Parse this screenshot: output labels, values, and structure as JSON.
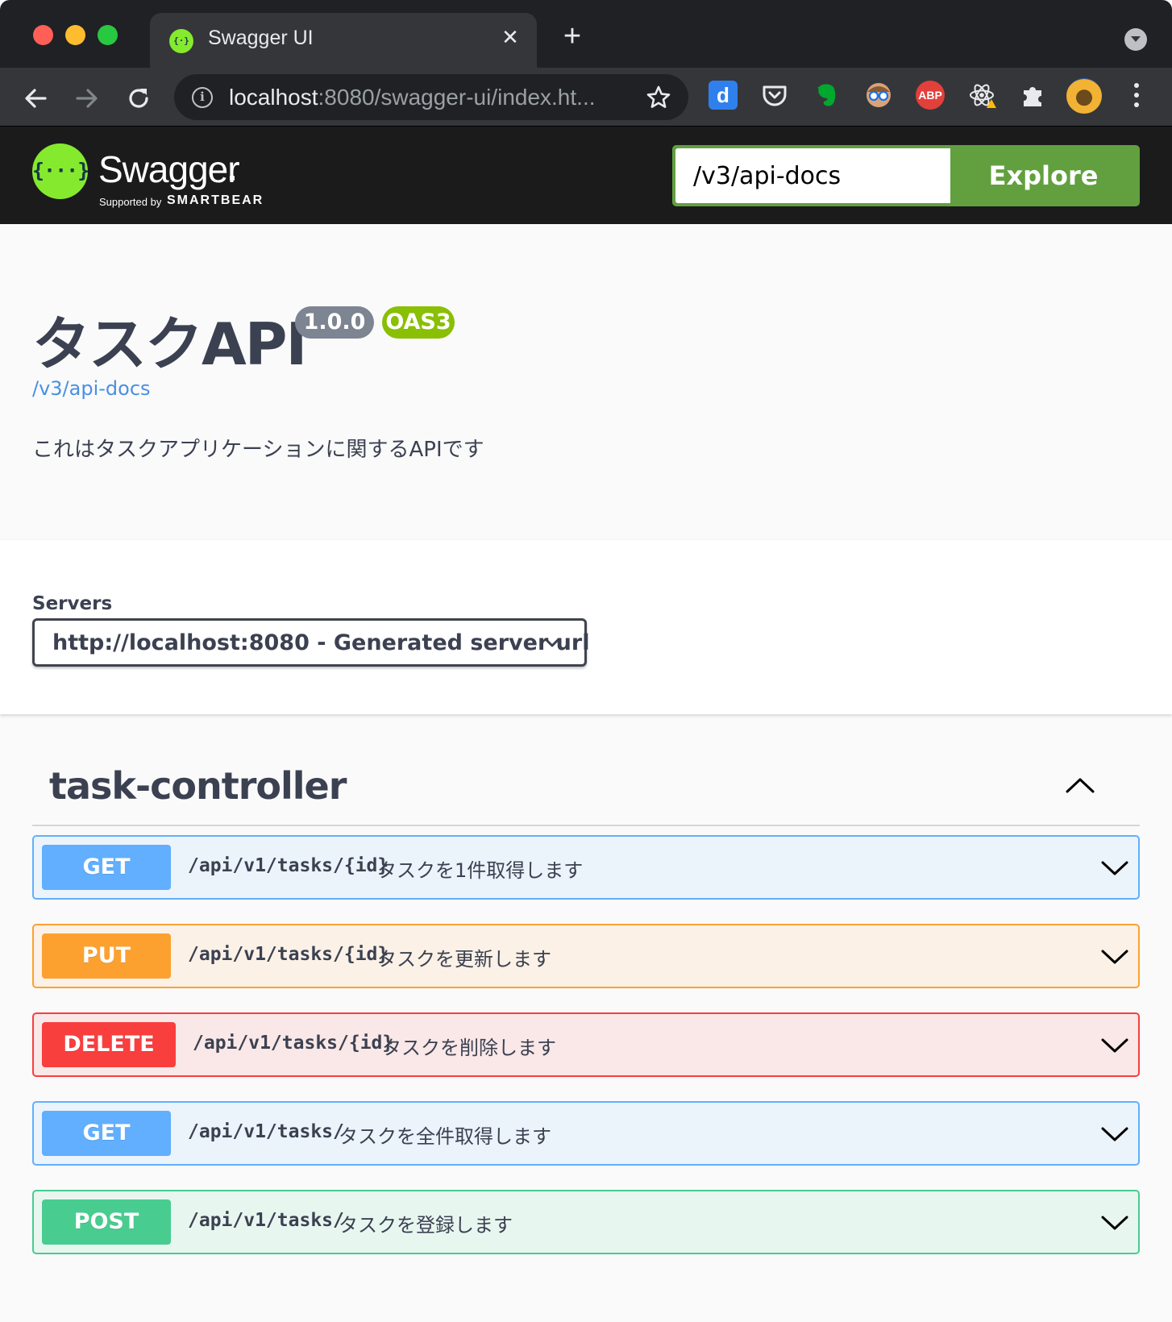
{
  "browser": {
    "tab_title": "Swagger UI",
    "tab_close": "✕",
    "new_tab": "+",
    "url_host": "localhost",
    "url_rest": ":8080/swagger-ui/index.ht...",
    "extensions": [
      "d",
      "pocket-icon",
      "evernote-icon",
      "glasses-icon",
      "ABP",
      "react-icon",
      "puzzle-icon",
      "avatar"
    ]
  },
  "topbar": {
    "logo_text": "Swagger",
    "logo_glyph": "{···}",
    "favicon_glyph": "{·}",
    "supported_by": "Supported by",
    "smartbear": "SMARTBEAR",
    "explore_value": "/v3/api-docs",
    "explore_label": "Explore"
  },
  "info": {
    "title": "タスクAPI",
    "version": "1.0.0",
    "oas": "OAS3",
    "url": "/v3/api-docs",
    "description": "これはタスクアプリケーションに関するAPIです"
  },
  "servers": {
    "label": "Servers",
    "selected": "http://localhost:8080 - Generated server url"
  },
  "tag": {
    "name": "task-controller"
  },
  "operations": [
    {
      "method": "GET",
      "path": "/api/v1/tasks/{id}",
      "summary": "タスクを1件取得します"
    },
    {
      "method": "PUT",
      "path": "/api/v1/tasks/{id}",
      "summary": "タスクを更新します"
    },
    {
      "method": "DELETE",
      "path": "/api/v1/tasks/{id}",
      "summary": "タスクを削除します"
    },
    {
      "method": "GET",
      "path": "/api/v1/tasks/",
      "summary": "タスクを全件取得します"
    },
    {
      "method": "POST",
      "path": "/api/v1/tasks/",
      "summary": "タスクを登録します"
    }
  ],
  "colors": {
    "get": "#61affe",
    "put": "#fca130",
    "delete": "#f93e3e",
    "post": "#49cc90",
    "explore": "#62a03f",
    "swagger_green": "#85ea2d"
  }
}
